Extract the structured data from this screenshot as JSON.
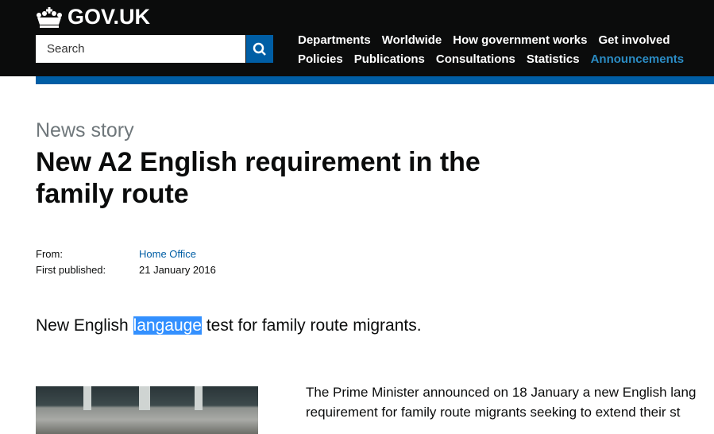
{
  "header": {
    "logo": "GOV.UK",
    "search_placeholder": "Search",
    "nav_row1": [
      "Departments",
      "Worldwide",
      "How government works",
      "Get involved"
    ],
    "nav_row2": [
      "Policies",
      "Publications",
      "Consultations",
      "Statistics",
      "Announcements"
    ],
    "active": "Announcements",
    "accent": "#005ea5"
  },
  "article": {
    "kind": "News story",
    "title": "New A2 English requirement in the family route",
    "from_label": "From:",
    "from_value": "Home Office",
    "published_label": "First published:",
    "published_value": "21 January 2016",
    "summary_before": "New English ",
    "summary_highlight": "langauge",
    "summary_after": " test for family route migrants.",
    "body_line1": "The Prime Minister announced on 18 January a new English lang",
    "body_line2": "requirement for family route migrants seeking to extend their st"
  }
}
